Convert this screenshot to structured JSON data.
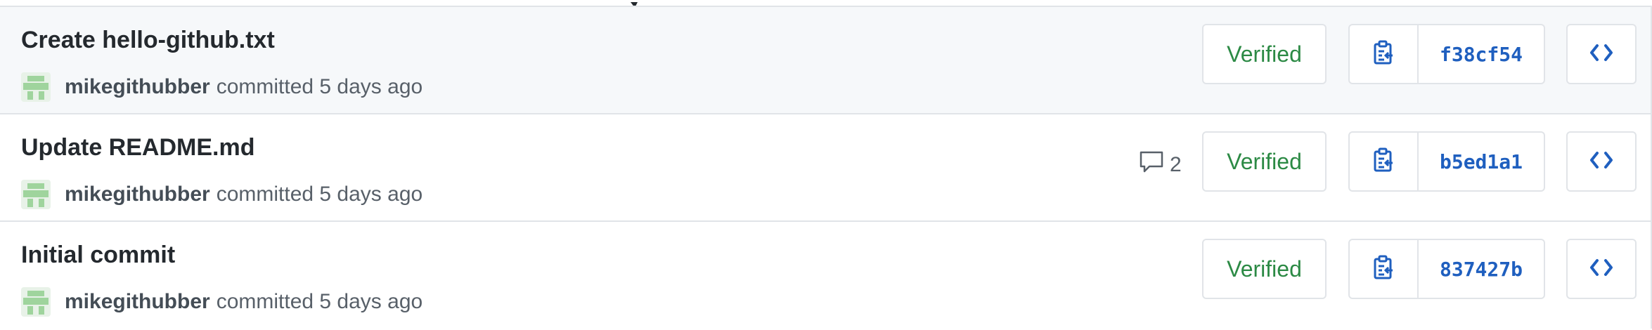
{
  "colors": {
    "verified": "#2c8a45",
    "sha_link": "#1f5fbf",
    "border": "#e1e4e8",
    "highlight_row": "#f6f8fa"
  },
  "icons": {
    "copy": "clippy-icon",
    "browse": "code-icon",
    "comment": "comment-icon",
    "avatar": "identicon"
  },
  "commits": [
    {
      "title": "Create hello-github.txt",
      "author": "mikegithubber",
      "meta": "committed 5 days ago",
      "comments": null,
      "verified_label": "Verified",
      "sha": "f38cf54"
    },
    {
      "title": "Update README.md",
      "author": "mikegithubber",
      "meta": "committed 5 days ago",
      "comments": "2",
      "verified_label": "Verified",
      "sha": "b5ed1a1"
    },
    {
      "title": "Initial commit",
      "author": "mikegithubber",
      "meta": "committed 5 days ago",
      "comments": null,
      "verified_label": "Verified",
      "sha": "837427b"
    }
  ]
}
